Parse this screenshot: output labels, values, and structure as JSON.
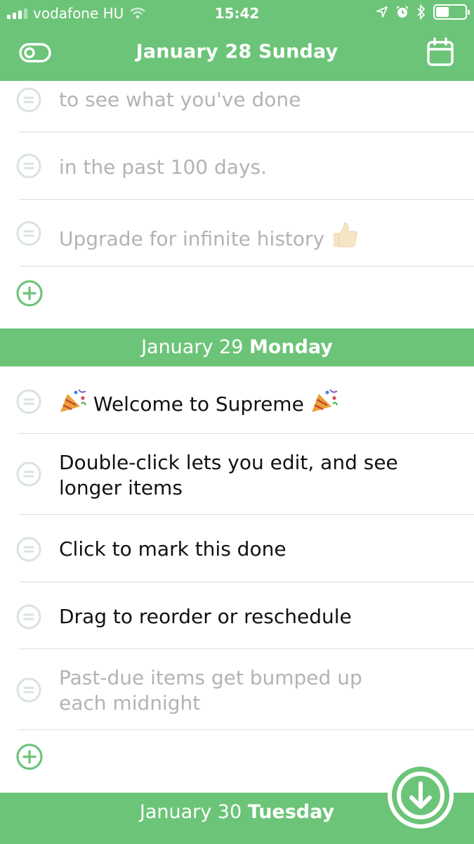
{
  "status_bar": {
    "carrier": "vodafone HU",
    "time": "15:42"
  },
  "header": {
    "title": "January 28 Sunday"
  },
  "day1": {
    "items": [
      {
        "text": "to see what you've done",
        "done": true
      },
      {
        "text": "in the past 100 days.",
        "done": true
      },
      {
        "text": "Upgrade for infinite history",
        "done": true
      }
    ]
  },
  "day2": {
    "date": "January 29",
    "weekday": "Monday",
    "items": [
      {
        "text": "Welcome to Supreme",
        "done": false
      },
      {
        "text": "Double-click lets you edit, and see longer items",
        "done": false
      },
      {
        "text": "Click to mark this done",
        "done": false
      },
      {
        "text": "Drag to reorder or reschedule",
        "done": false
      },
      {
        "text": "Past-due items get bumped up each midnight",
        "done": true
      }
    ]
  },
  "day3": {
    "date": "January 30",
    "weekday": "Tuesday"
  },
  "icons": {
    "signal": "signal-bars-icon",
    "wifi": "wifi-icon",
    "location": "location-arrow-icon",
    "alarm": "alarm-clock-icon",
    "bluetooth": "bluetooth-icon",
    "battery": "battery-icon",
    "toggle": "toggle-icon",
    "calendar": "calendar-icon",
    "handle": "drag-handle-icon",
    "add": "add-circle-icon",
    "party": "party-popper-icon",
    "thumbs": "thumbs-up-icon",
    "scroll": "arrow-down-circle-icon"
  },
  "colors": {
    "accent": "#6cc478",
    "done_text": "#b3b3b3",
    "handle": "#d9e4dc"
  }
}
